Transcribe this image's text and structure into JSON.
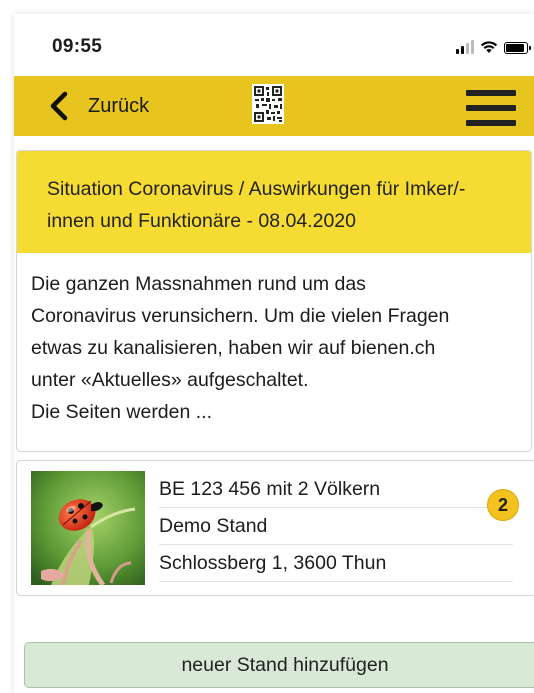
{
  "statusbar": {
    "time": "09:55"
  },
  "navbar": {
    "back_label": "Zurück",
    "background_color": "#e7c51e"
  },
  "news": {
    "title": "Situation Coronavirus / Auswirkungen für Imker/-innen und Funktionäre - 08.04.2020",
    "body_lines": [
      "Die ganzen Massnahmen rund um das",
      "Coronavirus verunsichern. Um die vielen Fragen",
      "etwas zu kanalisieren, haben wir auf bienen.ch",
      "unter «Aktuelles» aufgeschaltet.",
      "Die Seiten werden ..."
    ],
    "header_color": "#f6db32"
  },
  "stand": {
    "line1": "BE 123 456 mit 2 Völkern",
    "line2": "Demo Stand",
    "line3": "Schlossberg 1, 3600 Thun",
    "badge": "2",
    "image_icon": "ladybug-photo"
  },
  "add_button": {
    "label": "neuer Stand hinzufügen",
    "color": "#d8ead6"
  }
}
